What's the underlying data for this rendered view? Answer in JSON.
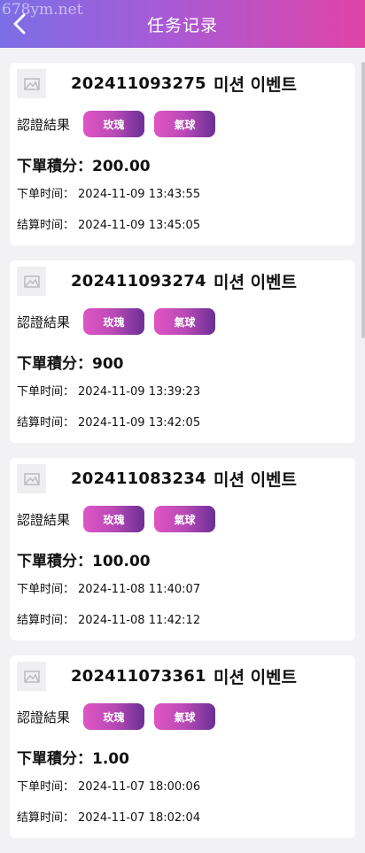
{
  "header": {
    "title": "任务记录",
    "watermark": "678ym.net"
  },
  "labels": {
    "verify": "認證結果",
    "points": "下單積分",
    "order_time": "下单时间",
    "settle_time": "结算时间",
    "colon": "："
  },
  "records": [
    {
      "id": "202411093275",
      "event": "미션 이벤트",
      "tags": [
        "玫瑰",
        "氣球"
      ],
      "points": "200.00",
      "order_time": "2024-11-09 13:43:55",
      "settle_time": "2024-11-09 13:45:05"
    },
    {
      "id": "202411093274",
      "event": "미션 이벤트",
      "tags": [
        "玫瑰",
        "氣球"
      ],
      "points": "900",
      "order_time": "2024-11-09 13:39:23",
      "settle_time": "2024-11-09 13:42:05"
    },
    {
      "id": "202411083234",
      "event": "미션 이벤트",
      "tags": [
        "玫瑰",
        "氣球"
      ],
      "points": "100.00",
      "order_time": "2024-11-08 11:40:07",
      "settle_time": "2024-11-08 11:42:12"
    },
    {
      "id": "202411073361",
      "event": "미션 이벤트",
      "tags": [
        "玫瑰",
        "氣球"
      ],
      "points": "1.00",
      "order_time": "2024-11-07 18:00:06",
      "settle_time": "2024-11-07 18:02:04"
    }
  ],
  "colors": {
    "header_start": "#7b6fe6",
    "header_end": "#e043a6",
    "tag_start": "#e055c4",
    "tag_end": "#6a2f95"
  },
  "icons": {
    "back": "chevron-left-icon",
    "thumb": "image-placeholder-icon"
  }
}
